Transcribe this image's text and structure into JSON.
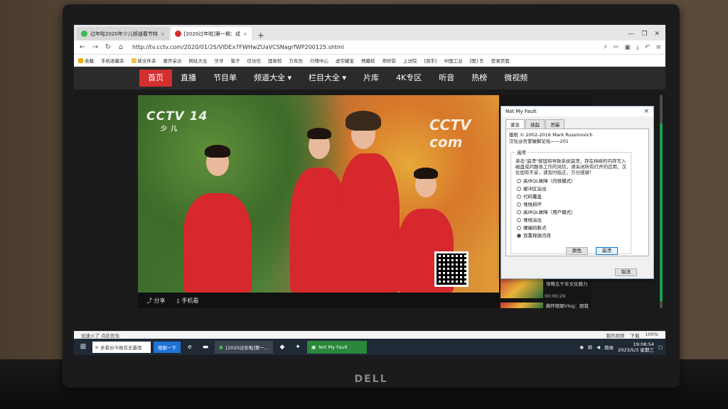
{
  "browser": {
    "tabs": [
      {
        "label": "过年啦2020年少儿频道春节特",
        "icon_color": "#3cba54"
      },
      {
        "label": "[2020过年啦]第一期：成",
        "icon_color": "#d32f2f"
      }
    ],
    "new_tab": "+",
    "url": "http://tv.cctv.com/2020/01/25/VIDEx7FWHwZUaVCSNagrfWP200125.shtml",
    "bookmarks": [
      "收藏",
      "手机收藏夹",
      "新文件夹",
      "喜开采访",
      "网址大全",
      "牙牙",
      "猫子",
      "信访信",
      "国家校",
      "万年历",
      "行情中心",
      "虚空藏宝",
      "预藏校",
      "师好前",
      "上访院",
      "[到手]",
      "中国工业",
      "[图] 东",
      "登录页面"
    ]
  },
  "site_nav": {
    "items": [
      "首页",
      "直播",
      "节目单",
      "频道大全 ▾",
      "栏目大全 ▾",
      "片库",
      "4K专区",
      "听音",
      "热榜",
      "微视频"
    ],
    "active_index": 0
  },
  "video": {
    "logo": "CCTV",
    "logo_channel": "14",
    "logo_sub": "少 儿",
    "logo2": "CCTV com",
    "share_label": "分享",
    "phone_label": "手机看"
  },
  "sidebar": {
    "items": [
      {
        "text": "看2020《过年啦》，领略五千年文化魅力",
        "time": "00:00:29"
      },
      {
        "text": "胸怀眼眼Vlog：跟我",
        "time": ""
      }
    ]
  },
  "dialog": {
    "title": "Not My Fault",
    "close": "×",
    "tabs": [
      "紧急",
      "挂起",
      "泄漏"
    ],
    "copyright": "版权 © 2002-2016 Mark Russinovich",
    "localized": "汉化@吾爱破解论坛——201",
    "group_label": "选项",
    "description": "单击\"崩溃\"按钮将导致系统崩溃，存在持续的内存写入磁盘或问题各工作的风险，请关闭所有打开的应用，汉化如有不妥，请及时指正，万分感谢！",
    "options": [
      {
        "label": "高IRQL故障（内核模式）",
        "selected": false
      },
      {
        "label": "缓冲区溢出",
        "selected": false
      },
      {
        "label": "代码覆盖",
        "selected": false
      },
      {
        "label": "堆栈损坏",
        "selected": false
      },
      {
        "label": "高IRQL故障（用户模式）",
        "selected": false
      },
      {
        "label": "堆栈溢出",
        "selected": false
      },
      {
        "label": "硬编码断点",
        "selected": false
      },
      {
        "label": "双重释放内存",
        "selected": true
      }
    ],
    "color_button": "颜色",
    "crash_button": "崩溃",
    "cancel_button": "取消"
  },
  "statusbar": {
    "left": "加速火了 点此优化",
    "right": [
      "我的视频",
      "下载",
      "100%"
    ]
  },
  "taskbar": {
    "search_placeholder": "多看份今晚有无暴雨",
    "search_button": "搜索一下",
    "apps": [
      "[2020过年啦]第一...",
      "Not My Fault"
    ],
    "ime": "简体",
    "time": "19:08:54",
    "date": "2023/5/3 星期三"
  },
  "laptop_brand": "DELL",
  "colors": {
    "accent": "#d32f2f",
    "taskbar": "#1f2a36",
    "notmyfault_task": "#29883a"
  }
}
